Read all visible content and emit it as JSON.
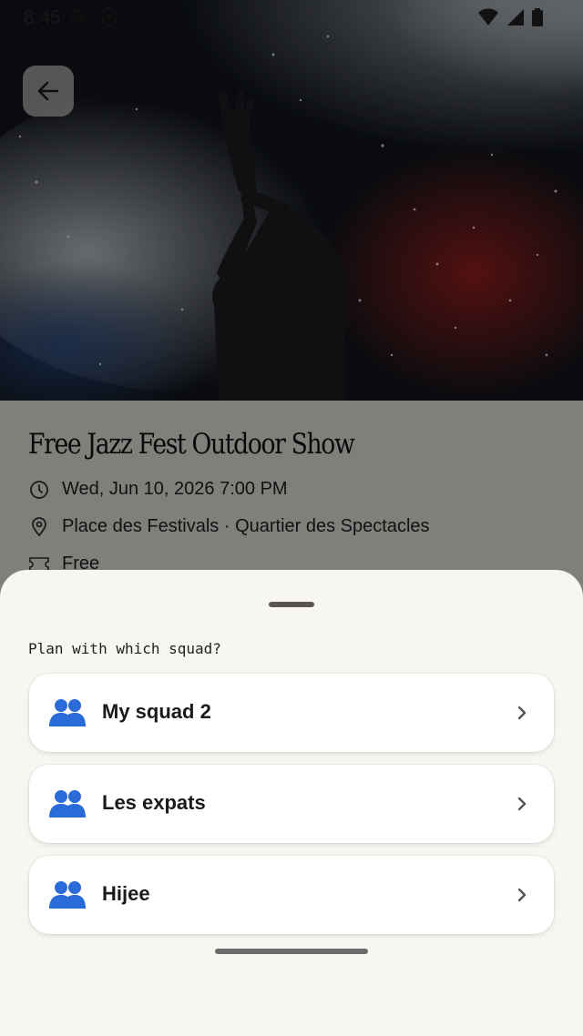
{
  "status_bar": {
    "time": "8:45",
    "g_letter": "G"
  },
  "event": {
    "title": "Free Jazz Fest Outdoor Show",
    "datetime": "Wed, Jun 10, 2026 7:00 PM",
    "location": "Place des Festivals · Quartier des Spectacles",
    "price": "Free"
  },
  "sheet": {
    "title": "Plan with which squad?",
    "squads": [
      {
        "name": "My squad 2"
      },
      {
        "name": "Les expats"
      },
      {
        "name": "Hijee"
      }
    ]
  },
  "colors": {
    "sheet_bg": "#f8f6f1",
    "card_bg": "#ffffff",
    "squad_icon": "#2a6ad9"
  }
}
